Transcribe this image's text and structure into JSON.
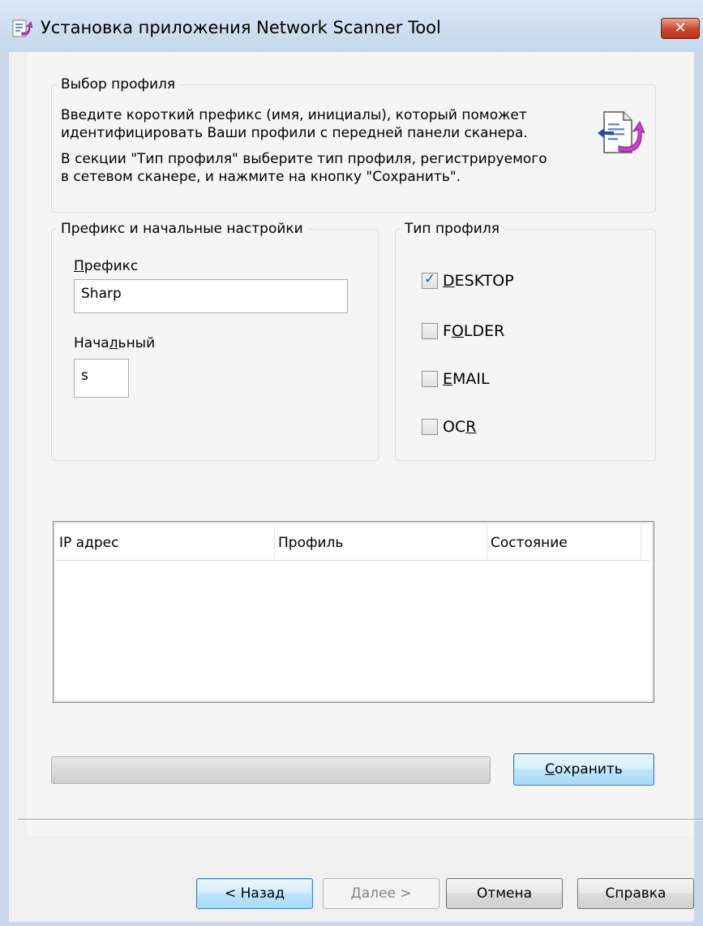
{
  "window": {
    "title": "Установка приложения Network Scanner Tool",
    "close_label": "✕"
  },
  "profile_selection": {
    "legend": "Выбор профиля",
    "description_1_line_1": "Введите короткий префикс (имя, инициалы), который поможет",
    "description_1_line_2": "идентифицировать Ваши профили с передней панели сканера.",
    "description_2_line_1": "В секции \"Тип профиля\" выберите тип профиля, регистрируемого",
    "description_2_line_2": "в сетевом сканере, и нажмите на кнопку \"Сохранить\".",
    "icon": "document-arrow-icon"
  },
  "prefix_settings": {
    "legend": "Префикс и начальные настройки",
    "prefix_label_accel": "П",
    "prefix_label_rest": "рефикс",
    "prefix_value": "Sharp",
    "initial_label_pre": "Нача",
    "initial_label_accel": "л",
    "initial_label_post": "ьный",
    "initial_value": "s"
  },
  "profile_type": {
    "legend": "Тип профиля",
    "options": [
      {
        "pre": "",
        "accel": "D",
        "post": "ESKTOP",
        "checked": true
      },
      {
        "pre": "F",
        "accel": "O",
        "post": "LDER",
        "checked": false
      },
      {
        "pre": "",
        "accel": "E",
        "post": "MAIL",
        "checked": false
      },
      {
        "pre": "OC",
        "accel": "R",
        "post": "",
        "checked": false
      }
    ]
  },
  "list": {
    "columns": [
      "IP адрес",
      "Профиль",
      "Состояние"
    ],
    "rows": []
  },
  "progress": {
    "value": 0
  },
  "save_button": {
    "accel": "С",
    "rest": "охранить"
  },
  "footer": {
    "back_label": "< Назад",
    "next_accel": "Д",
    "next_rest": "алее >",
    "cancel_label": "Отмена",
    "help_label": "Справка"
  },
  "colors": {
    "title_bar": "#c5d7ec",
    "close_button": "#c9452b",
    "checkbox_check": "#2a4fa3",
    "default_button_border": "#3c7fb1"
  }
}
